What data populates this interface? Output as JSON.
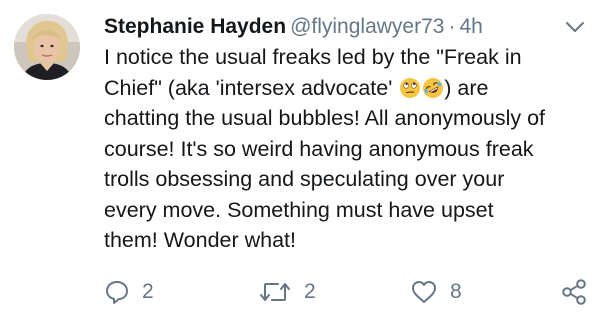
{
  "tweet": {
    "author_name": "Stephanie Hayden",
    "handle": "@flyinglawyer73",
    "separator": "·",
    "time": "4h",
    "lines": {
      "l1": "I notice the usual freaks led by the \"Freak in",
      "l2a": "Chief\" (aka 'intersex advocate' ",
      "l2b": ") are",
      "l3": "chatting the usual bubbles! All anonymously of",
      "l4": "course! It's so weird having anonymous freak",
      "l5": "trolls obsessing and speculating over your",
      "l6": "every move. Something must have upset",
      "l7": "them! Wonder what!"
    },
    "emojis": [
      "face-with-rolling-eyes",
      "rolling-on-floor-laughing"
    ]
  },
  "actions": {
    "reply_count": "2",
    "retweet_count": "2",
    "like_count": "8"
  },
  "icons": {
    "reply": "reply-icon",
    "retweet": "retweet-icon",
    "like": "heart-icon",
    "share": "share-icon",
    "caret": "chevron-down-icon"
  },
  "colors": {
    "text": "#14171a",
    "secondary": "#657786"
  }
}
